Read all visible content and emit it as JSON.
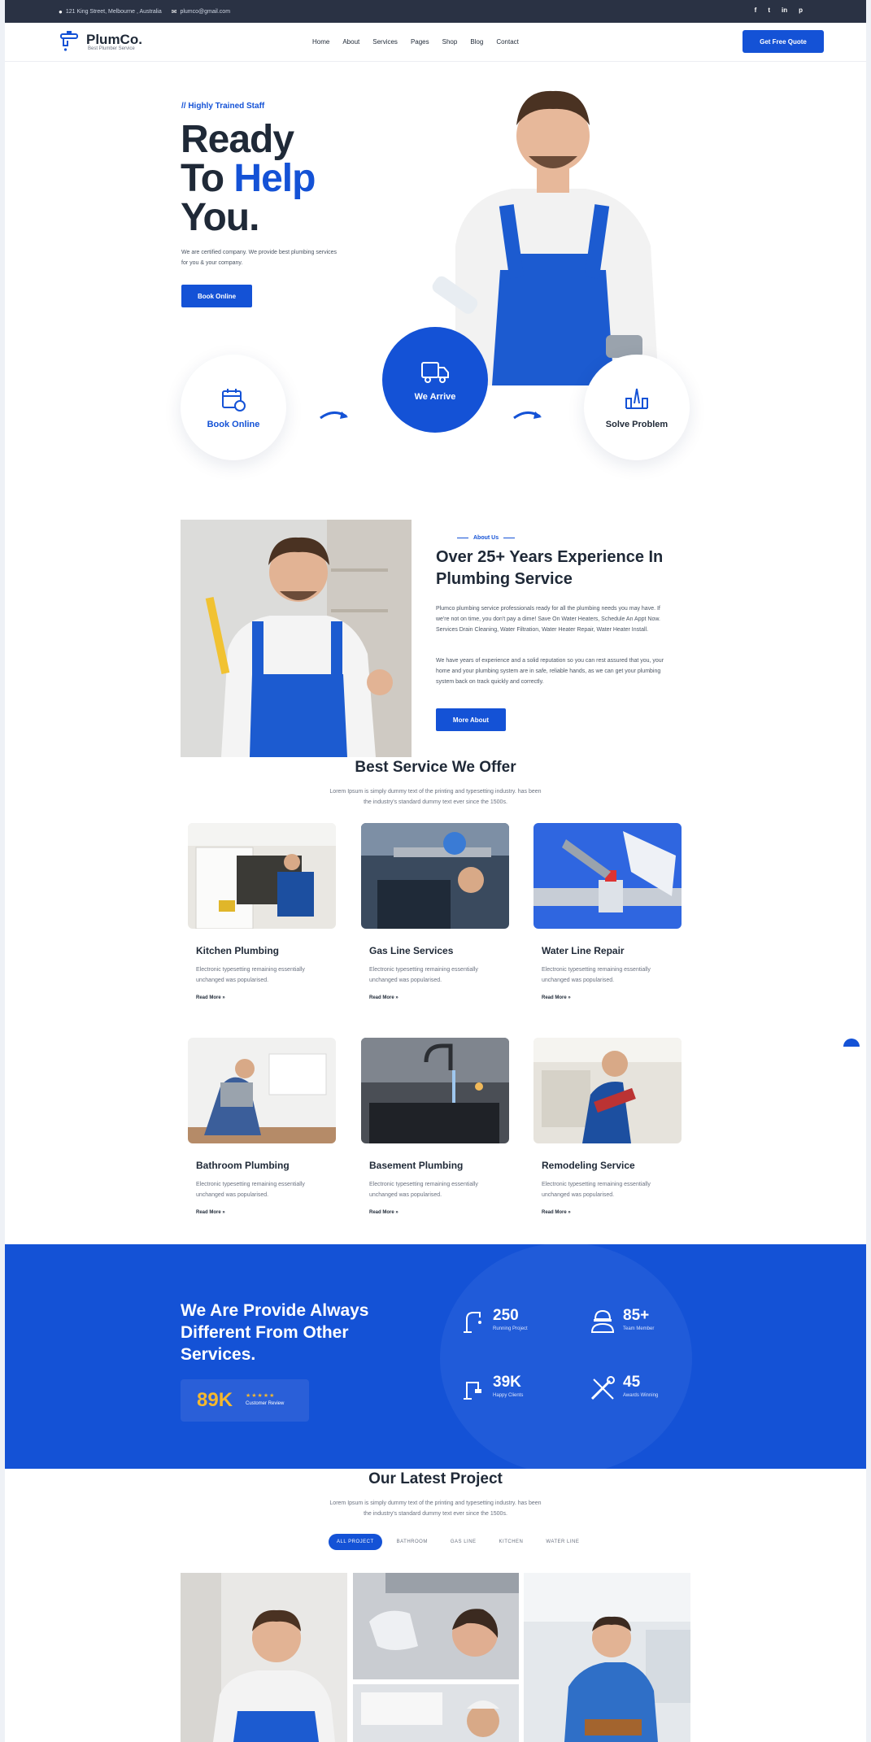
{
  "topbar": {
    "address": "121 King Street, Melbourne , Australia",
    "email": "plumco@gmail.com",
    "social": [
      "f",
      "t",
      "in",
      "p"
    ]
  },
  "nav": {
    "logo_name": "PlumCo.",
    "logo_tagline": "Best Plumber Service",
    "menu": [
      "Home",
      "About",
      "Services",
      "Pages",
      "Shop",
      "Blog",
      "Contact"
    ],
    "cta": "Get Free Quote"
  },
  "hero": {
    "kicker": "// Highly Trained Staff",
    "title_line1": "Ready",
    "title_line2a": "To ",
    "title_line2b": "Help",
    "title_line3": "You.",
    "description": "We are certified company. We provide best plumbing services for you & your company.",
    "button": "Book Online",
    "steps": [
      {
        "label": "Book Online",
        "icon": "calendar-icon"
      },
      {
        "label": "We Arrive",
        "icon": "truck-icon"
      },
      {
        "label": "Solve Problem",
        "icon": "pipe-repair-icon"
      }
    ]
  },
  "about": {
    "kicker": "About Us",
    "title": "Over 25+ Years Experience In Plumbing Service",
    "paragraph1": "Plumco plumbing service professionals ready for all the plumbing needs you may have. If we're not on time, you don't pay a dime! Save On Water Heaters, Schedule An Appt Now. Services Drain Cleaning, Water Filtration, Water Heater Repair, Water Heater Install.",
    "paragraph2": "We have years of experience and a solid reputation so you can rest assured that you, your home and your plumbing system are in safe, reliable hands, as we can get your plumbing system back on track quickly and correctly.",
    "button": "More About"
  },
  "services": {
    "title": "Best Service We Offer",
    "subtitle_line1": "Lorem Ipsum is simply dummy text of the printing and typesetting industry. has been",
    "subtitle_line2": "the industry's standard dummy text ever since the 1500s.",
    "items": [
      {
        "title": "Kitchen Plumbing",
        "desc": "Electronic typesetting remaining essentially unchanged was popularised.",
        "link": "Read More »"
      },
      {
        "title": "Gas Line Services",
        "desc": "Electronic typesetting remaining essentially unchanged was popularised.",
        "link": "Read More »"
      },
      {
        "title": "Water Line Repair",
        "desc": "Electronic typesetting remaining essentially unchanged was popularised.",
        "link": "Read More »"
      },
      {
        "title": "Bathroom Plumbing",
        "desc": "Electronic typesetting remaining essentially unchanged was popularised.",
        "link": "Read More »"
      },
      {
        "title": "Basement Plumbing",
        "desc": "Electronic typesetting remaining essentially unchanged was popularised.",
        "link": "Read More »"
      },
      {
        "title": "Remodeling Service",
        "desc": "Electronic typesetting remaining essentially unchanged was popularised.",
        "link": "Read More »"
      }
    ]
  },
  "stats": {
    "title": "We Are Provide Always Different From Other Services.",
    "rating_value": "89K",
    "rating_stars": "★★★★★",
    "rating_label": "Customer Review",
    "items": [
      {
        "value": "250",
        "label": "Running Project"
      },
      {
        "value": "85+",
        "label": "Team Member"
      },
      {
        "value": "39K",
        "label": "Happy Clients"
      },
      {
        "value": "45",
        "label": "Awards Winning"
      }
    ]
  },
  "projects": {
    "title": "Our Latest Project",
    "subtitle_line1": "Lorem Ipsum is simply dummy text of the printing and typesetting industry. has been",
    "subtitle_line2": "the industry's standard dummy text ever since the 1500s.",
    "tabs": [
      "ALL PROJECT",
      "BATHROOM",
      "GAS LINE",
      "KITCHEN",
      "WATER LINE"
    ],
    "active_tab": "ALL PROJECT"
  },
  "colors": {
    "primary": "#1452d6",
    "dark": "#2a3244",
    "accent_gold": "#f5b82e"
  }
}
